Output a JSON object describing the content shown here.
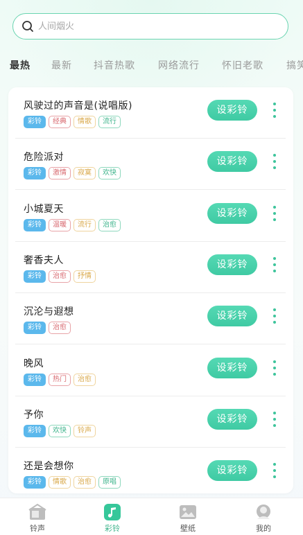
{
  "search": {
    "placeholder": "人间烟火"
  },
  "tabs": [
    {
      "label": "最热",
      "active": true
    },
    {
      "label": "最新"
    },
    {
      "label": "抖音热歌"
    },
    {
      "label": "网络流行"
    },
    {
      "label": "怀旧老歌"
    },
    {
      "label": "搞笑"
    }
  ],
  "songs": [
    {
      "title": "风驶过的声音是(说唱版)",
      "tags": [
        "彩铃",
        "经典",
        "情歌",
        "流行"
      ]
    },
    {
      "title": "危险派对",
      "tags": [
        "彩铃",
        "激情",
        "寂寞",
        "欢快"
      ]
    },
    {
      "title": "小城夏天",
      "tags": [
        "彩铃",
        "温暖",
        "流行",
        "治愈"
      ]
    },
    {
      "title": "奢香夫人",
      "tags": [
        "彩铃",
        "治愈",
        "抒情"
      ]
    },
    {
      "title": "沉沦与遐想",
      "tags": [
        "彩铃",
        "治愈"
      ]
    },
    {
      "title": "晚风",
      "tags": [
        "彩铃",
        "热门",
        "治愈"
      ]
    },
    {
      "title": "予你",
      "tags": [
        "彩铃",
        "欢快",
        "铃声"
      ]
    },
    {
      "title": "还是会想你",
      "tags": [
        "彩铃",
        "情歌",
        "治愈",
        "原唱"
      ]
    }
  ],
  "set_button_label": "设彩铃",
  "bottom_nav": [
    {
      "label": "铃声",
      "icon": "house-icon"
    },
    {
      "label": "彩铃",
      "icon": "music-note-icon",
      "active": true
    },
    {
      "label": "壁纸",
      "icon": "image-icon"
    },
    {
      "label": "我的",
      "icon": "profile-icon"
    }
  ],
  "colors": {
    "accent": "#3fcaa3",
    "tag_primary": "#5bb8ec",
    "tag_red": "#d86a70",
    "tag_gold": "#d9a84a",
    "tag_green": "#3fb48c"
  }
}
